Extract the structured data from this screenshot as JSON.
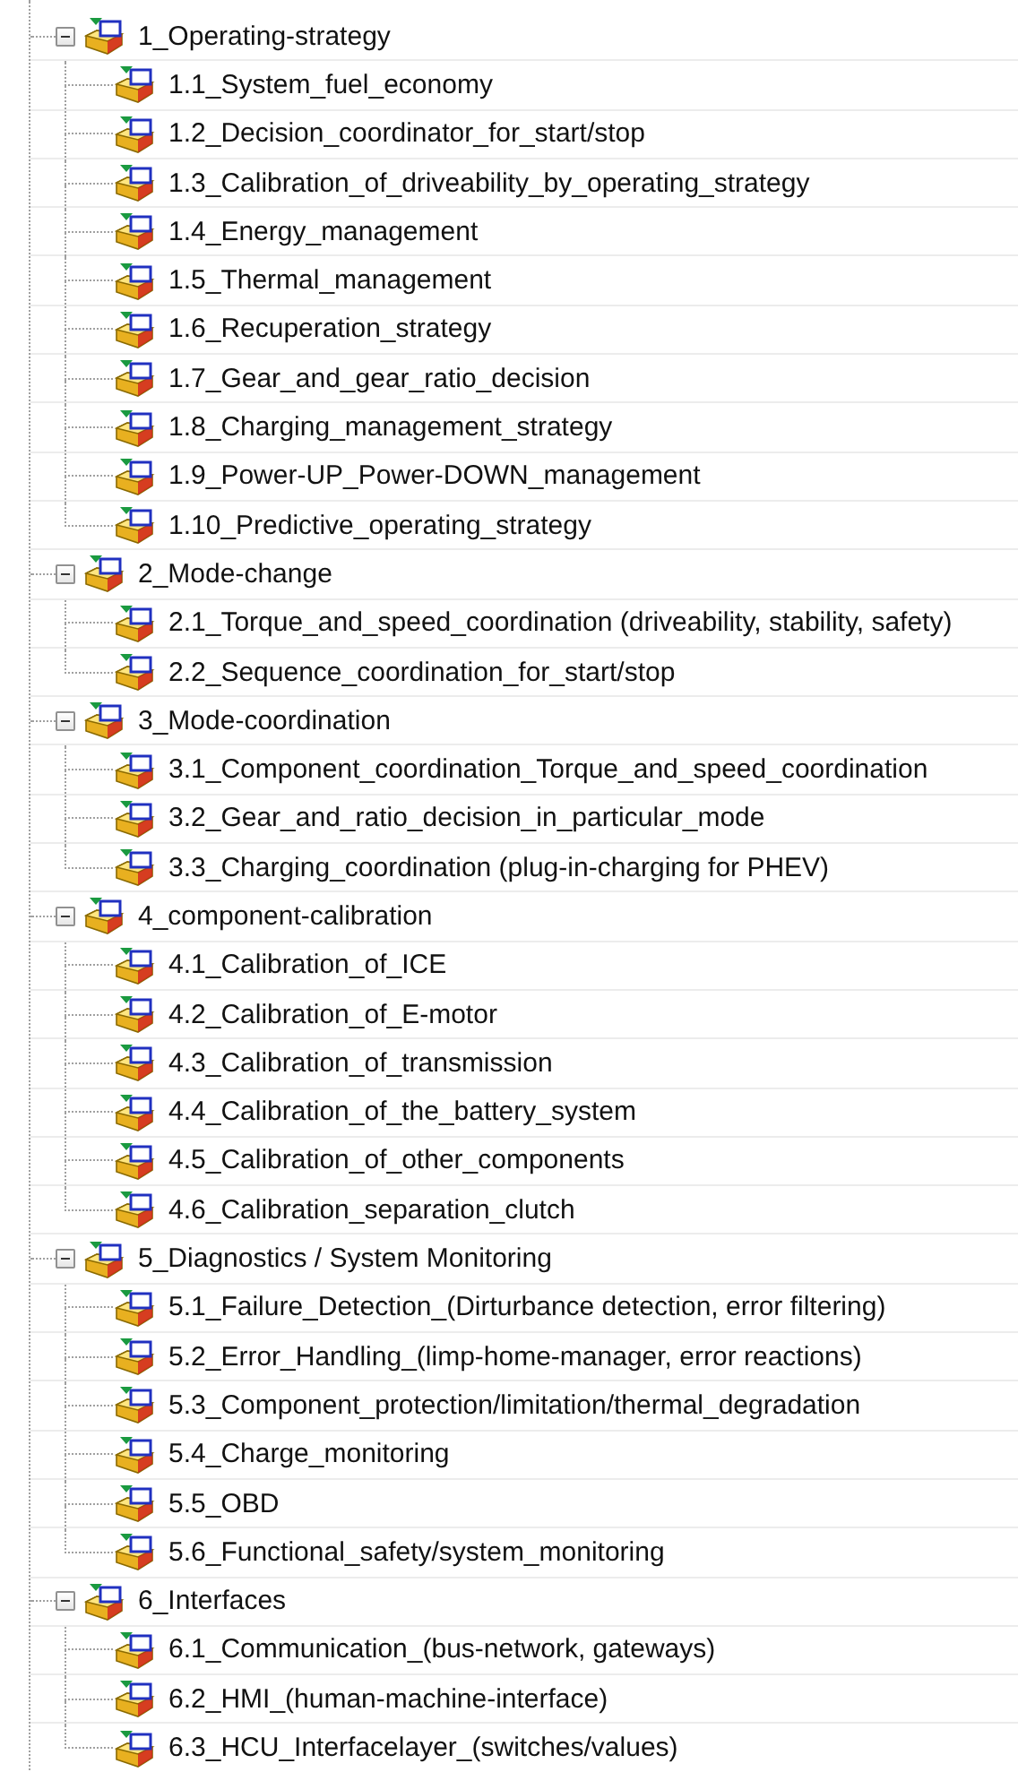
{
  "tree": [
    {
      "label": "1_Operating-strategy",
      "expanded": true,
      "children": [
        {
          "label": "1.1_System_fuel_economy"
        },
        {
          "label": "1.2_Decision_coordinator_for_start/stop"
        },
        {
          "label": "1.3_Calibration_of_driveability_by_operating_strategy"
        },
        {
          "label": "1.4_Energy_management"
        },
        {
          "label": "1.5_Thermal_management"
        },
        {
          "label": "1.6_Recuperation_strategy"
        },
        {
          "label": "1.7_Gear_and_gear_ratio_decision"
        },
        {
          "label": "1.8_Charging_management_strategy"
        },
        {
          "label": "1.9_Power-UP_Power-DOWN_management"
        },
        {
          "label": "1.10_Predictive_operating_strategy"
        }
      ]
    },
    {
      "label": "2_Mode-change",
      "expanded": true,
      "children": [
        {
          "label": "2.1_Torque_and_speed_coordination (driveability, stability, safety)"
        },
        {
          "label": "2.2_Sequence_coordination_for_start/stop"
        }
      ]
    },
    {
      "label": "3_Mode-coordination",
      "expanded": true,
      "children": [
        {
          "label": "3.1_Component_coordination_Torque_and_speed_coordination"
        },
        {
          "label": "3.2_Gear_and_ratio_decision_in_particular_mode"
        },
        {
          "label": "3.3_Charging_coordination (plug-in-charging for PHEV)"
        }
      ]
    },
    {
      "label": "4_component-calibration",
      "expanded": true,
      "children": [
        {
          "label": "4.1_Calibration_of_ICE"
        },
        {
          "label": "4.2_Calibration_of_E-motor"
        },
        {
          "label": "4.3_Calibration_of_transmission"
        },
        {
          "label": "4.4_Calibration_of_the_battery_system"
        },
        {
          "label": "4.5_Calibration_of_other_components"
        },
        {
          "label": "4.6_Calibration_separation_clutch"
        }
      ]
    },
    {
      "label": "5_Diagnostics / System Monitoring",
      "expanded": true,
      "children": [
        {
          "label": "5.1_Failure_Detection_(Dirturbance detection, error filtering)"
        },
        {
          "label": "5.2_Error_Handling_(limp-home-manager, error reactions)"
        },
        {
          "label": "5.3_Component_protection/limitation/thermal_degradation"
        },
        {
          "label": "5.4_Charge_monitoring"
        },
        {
          "label": "5.5_OBD"
        },
        {
          "label": "5.6_Functional_safety/system_monitoring"
        }
      ]
    },
    {
      "label": "6_Interfaces",
      "expanded": true,
      "children": [
        {
          "label": "6.1_Communication_(bus-network, gateways)"
        },
        {
          "label": "6.2_HMI_(human-machine-interface)"
        },
        {
          "label": "6.3_HCU_Interfacelayer_(switches/values)"
        }
      ]
    }
  ]
}
